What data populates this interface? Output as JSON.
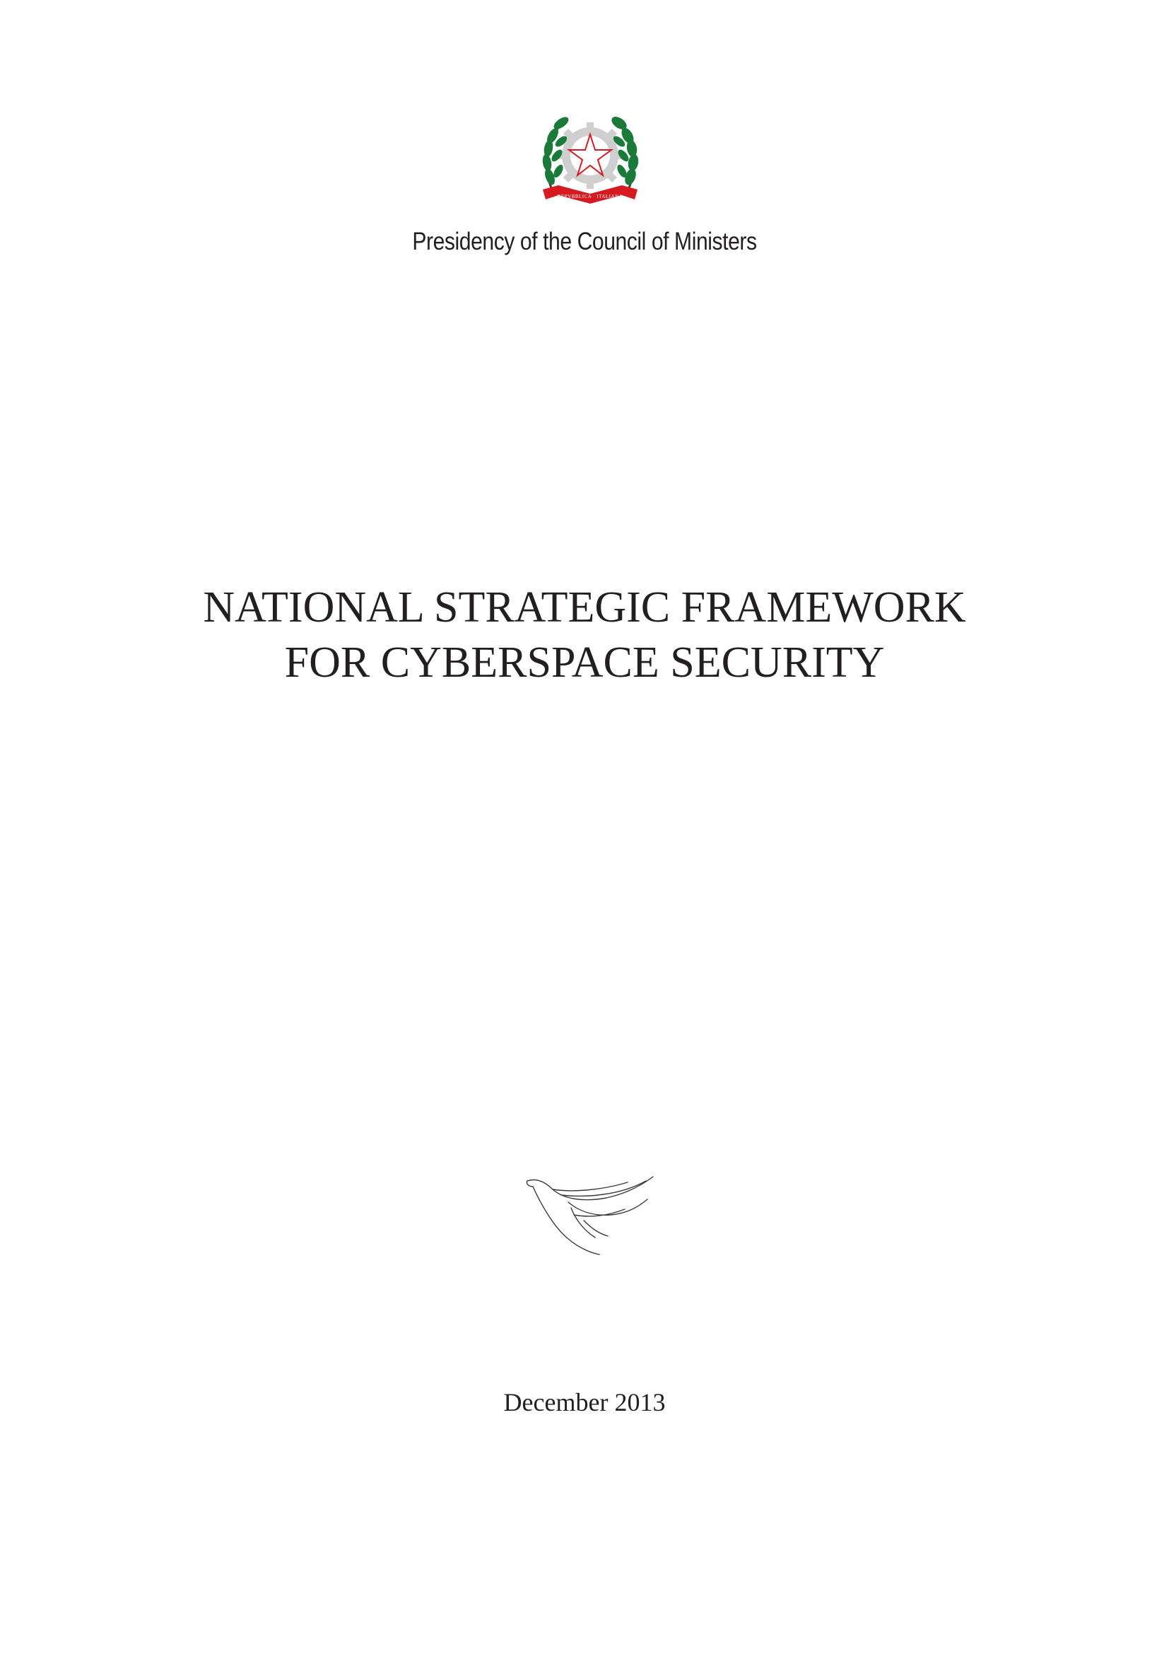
{
  "issuer": "Presidency of the Council of Ministers",
  "emblem": {
    "icon": "italian-republic-emblem-icon",
    "ribbon_text": "REPVBBLICA ITALIANA",
    "colors": {
      "leaves": "#1a7a3a",
      "ribbon": "#d71920",
      "star_outline": "#d71920",
      "cogwheel": "#c8c8c8"
    }
  },
  "title": {
    "line1": "NATIONAL STRATEGIC FRAMEWORK",
    "line2": "FOR CYBERSPACE SECURITY"
  },
  "ornament": {
    "icon": "dove-line-icon"
  },
  "date": "December 2013"
}
